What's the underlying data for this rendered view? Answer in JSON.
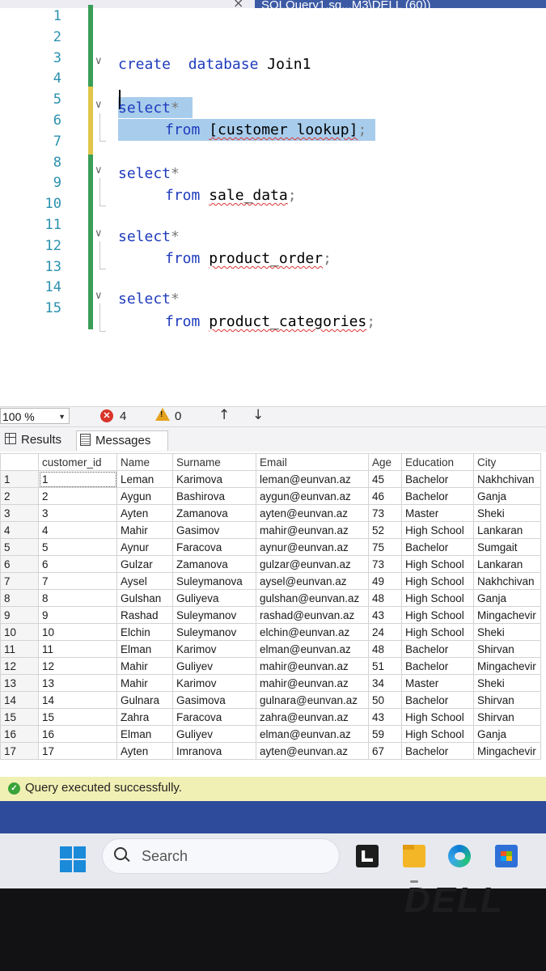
{
  "window": {
    "tab_title": "SQLQuery1.sq...M3\\DELL (60))",
    "tab_close": "×"
  },
  "editor": {
    "line_numbers": [
      "1",
      "2",
      "3",
      "4",
      "5",
      "6",
      "7",
      "8",
      "9",
      "10",
      "11",
      "12",
      "13",
      "14",
      "15"
    ],
    "code": {
      "l3_kw": "create",
      "l3_kw2": "database",
      "l3_name": "Join1",
      "select_kw": "select",
      "star": "*",
      "from_kw": "from",
      "t1": "[customer lookup]",
      "t2": "sale_data",
      "t3": "product_order",
      "t4": "product_categories",
      "semicolon": ";"
    }
  },
  "status_strip": {
    "zoom": "100 %",
    "errors": "4",
    "warnings": "0"
  },
  "results": {
    "tabs": [
      "Results",
      "Messages"
    ],
    "columns": [
      "customer_id",
      "Name",
      "Surname",
      "Email",
      "Age",
      "Education",
      "City"
    ],
    "rows": [
      [
        "1",
        "1",
        "Leman",
        "Karimova",
        "leman@eunvan.az",
        "45",
        "Bachelor",
        "Nakhchivan"
      ],
      [
        "2",
        "2",
        "Aygun",
        "Bashirova",
        "aygun@eunvan.az",
        "46",
        "Bachelor",
        "Ganja"
      ],
      [
        "3",
        "3",
        "Ayten",
        "Zamanova",
        "ayten@eunvan.az",
        "73",
        "Master",
        "Sheki"
      ],
      [
        "4",
        "4",
        "Mahir",
        "Gasimov",
        "mahir@eunvan.az",
        "52",
        "High School",
        "Lankaran"
      ],
      [
        "5",
        "5",
        "Aynur",
        "Faracova",
        "aynur@eunvan.az",
        "75",
        "Bachelor",
        "Sumgait"
      ],
      [
        "6",
        "6",
        "Gulzar",
        "Zamanova",
        "gulzar@eunvan.az",
        "73",
        "High School",
        "Lankaran"
      ],
      [
        "7",
        "7",
        "Aysel",
        "Suleymanova",
        "aysel@eunvan.az",
        "49",
        "High School",
        "Nakhchivan"
      ],
      [
        "8",
        "8",
        "Gulshan",
        "Guliyeva",
        "gulshan@eunvan.az",
        "48",
        "High School",
        "Ganja"
      ],
      [
        "9",
        "9",
        "Rashad",
        "Suleymanov",
        "rashad@eunvan.az",
        "43",
        "High School",
        "Mingachevir"
      ],
      [
        "10",
        "10",
        "Elchin",
        "Suleymanov",
        "elchin@eunvan.az",
        "24",
        "High School",
        "Sheki"
      ],
      [
        "11",
        "11",
        "Elman",
        "Karimov",
        "elman@eunvan.az",
        "48",
        "Bachelor",
        "Shirvan"
      ],
      [
        "12",
        "12",
        "Mahir",
        "Guliyev",
        "mahir@eunvan.az",
        "51",
        "Bachelor",
        "Mingachevir"
      ],
      [
        "13",
        "13",
        "Mahir",
        "Karimov",
        "mahir@eunvan.az",
        "34",
        "Master",
        "Sheki"
      ],
      [
        "14",
        "14",
        "Gulnara",
        "Gasimova",
        "gulnara@eunvan.az",
        "50",
        "Bachelor",
        "Shirvan"
      ],
      [
        "15",
        "15",
        "Zahra",
        "Faracova",
        "zahra@eunvan.az",
        "43",
        "High School",
        "Shirvan"
      ],
      [
        "16",
        "16",
        "Elman",
        "Guliyev",
        "elman@eunvan.az",
        "59",
        "High School",
        "Ganja"
      ],
      [
        "17",
        "17",
        "Ayten",
        "Imranova",
        "ayten@eunvan.az",
        "67",
        "Bachelor",
        "Mingachevir"
      ]
    ]
  },
  "query_status": "Query executed successfully.",
  "taskbar": {
    "search_placeholder": "Search"
  },
  "bezel_brand": "DELL",
  "colors": {
    "keyword": "#1f3cbd",
    "line_number": "#2b91af",
    "change_bar": "#3a9e57",
    "selection": "#a8cdec",
    "status_yellow": "#f0f0b4",
    "tab_blue": "#3c5aa4"
  }
}
